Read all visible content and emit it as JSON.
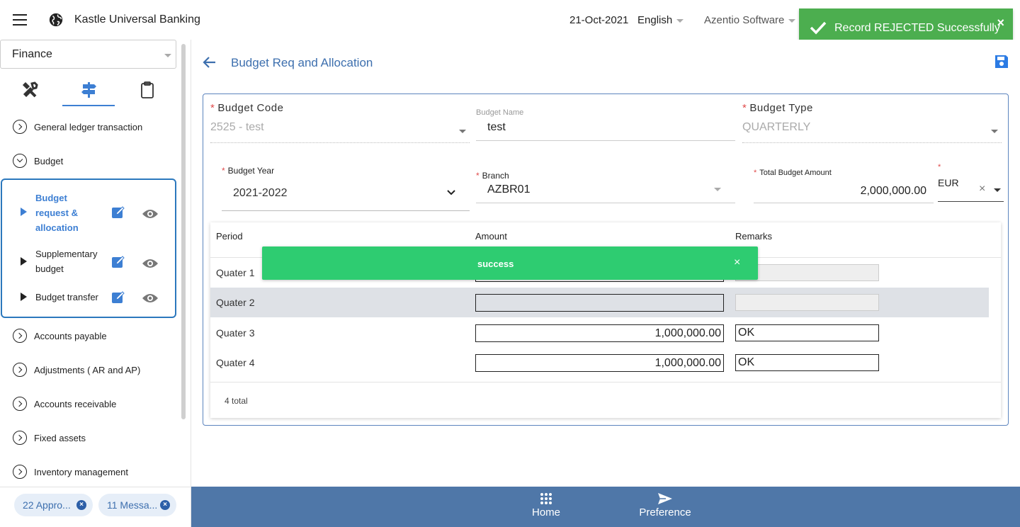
{
  "header": {
    "app_title": "Kastle Universal Banking",
    "date": "21-Oct-2021",
    "language": "English",
    "company": "Azentio Software"
  },
  "toast": {
    "message": "Record REJECTED Successfully",
    "close": "×",
    "color": "#4cae4f"
  },
  "sidebar": {
    "module": "Finance",
    "tool_tabs": [
      "tools-icon",
      "signpost-icon",
      "clipboard-icon"
    ],
    "items": [
      {
        "label": "General ledger transaction"
      },
      {
        "label": "Budget"
      },
      {
        "label": "Accounts payable"
      },
      {
        "label": "Adjustments ( AR and AP)"
      },
      {
        "label": "Accounts receivable"
      },
      {
        "label": "Fixed assets"
      },
      {
        "label": "Inventory management"
      }
    ],
    "budget_sub": [
      {
        "label": "Budget request & allocation"
      },
      {
        "label": "Supplementary budget"
      },
      {
        "label": "Budget transfer"
      }
    ],
    "chips": [
      {
        "label": "22 Appro..."
      },
      {
        "label": "11 Messa..."
      }
    ]
  },
  "main": {
    "title": "Budget Req and Allocation",
    "form": {
      "budget_code_label": "Budget Code",
      "budget_code_value": "2525 - test",
      "budget_name_label": "Budget Name",
      "budget_name_value": "test",
      "budget_type_label": "Budget Type",
      "budget_type_value": "QUARTERLY",
      "budget_year_label": "Budget Year",
      "budget_year_value": "2021-2022",
      "branch_label": "Branch",
      "branch_value": "AZBR01",
      "total_amount_label": "Total Budget Amount",
      "total_amount_value": "2,000,000.00",
      "currency_value": "EUR",
      "currency_clear": "×",
      "required_mark": "*"
    },
    "table": {
      "headers": [
        "Period",
        "Amount",
        "Remarks"
      ],
      "rows": [
        {
          "period": "Quater 1",
          "amount": "",
          "remarks": ""
        },
        {
          "period": "Quater 2",
          "amount": "",
          "remarks": ""
        },
        {
          "period": "Quater 3",
          "amount": "1,000,000.00",
          "remarks": "OK"
        },
        {
          "period": "Quater 4",
          "amount": "1,000,000.00",
          "remarks": "OK"
        }
      ],
      "total": "4 total"
    },
    "alert": {
      "text": "success",
      "close": "×"
    }
  },
  "bottom_bar": {
    "home": "Home",
    "preference": "Preference"
  }
}
